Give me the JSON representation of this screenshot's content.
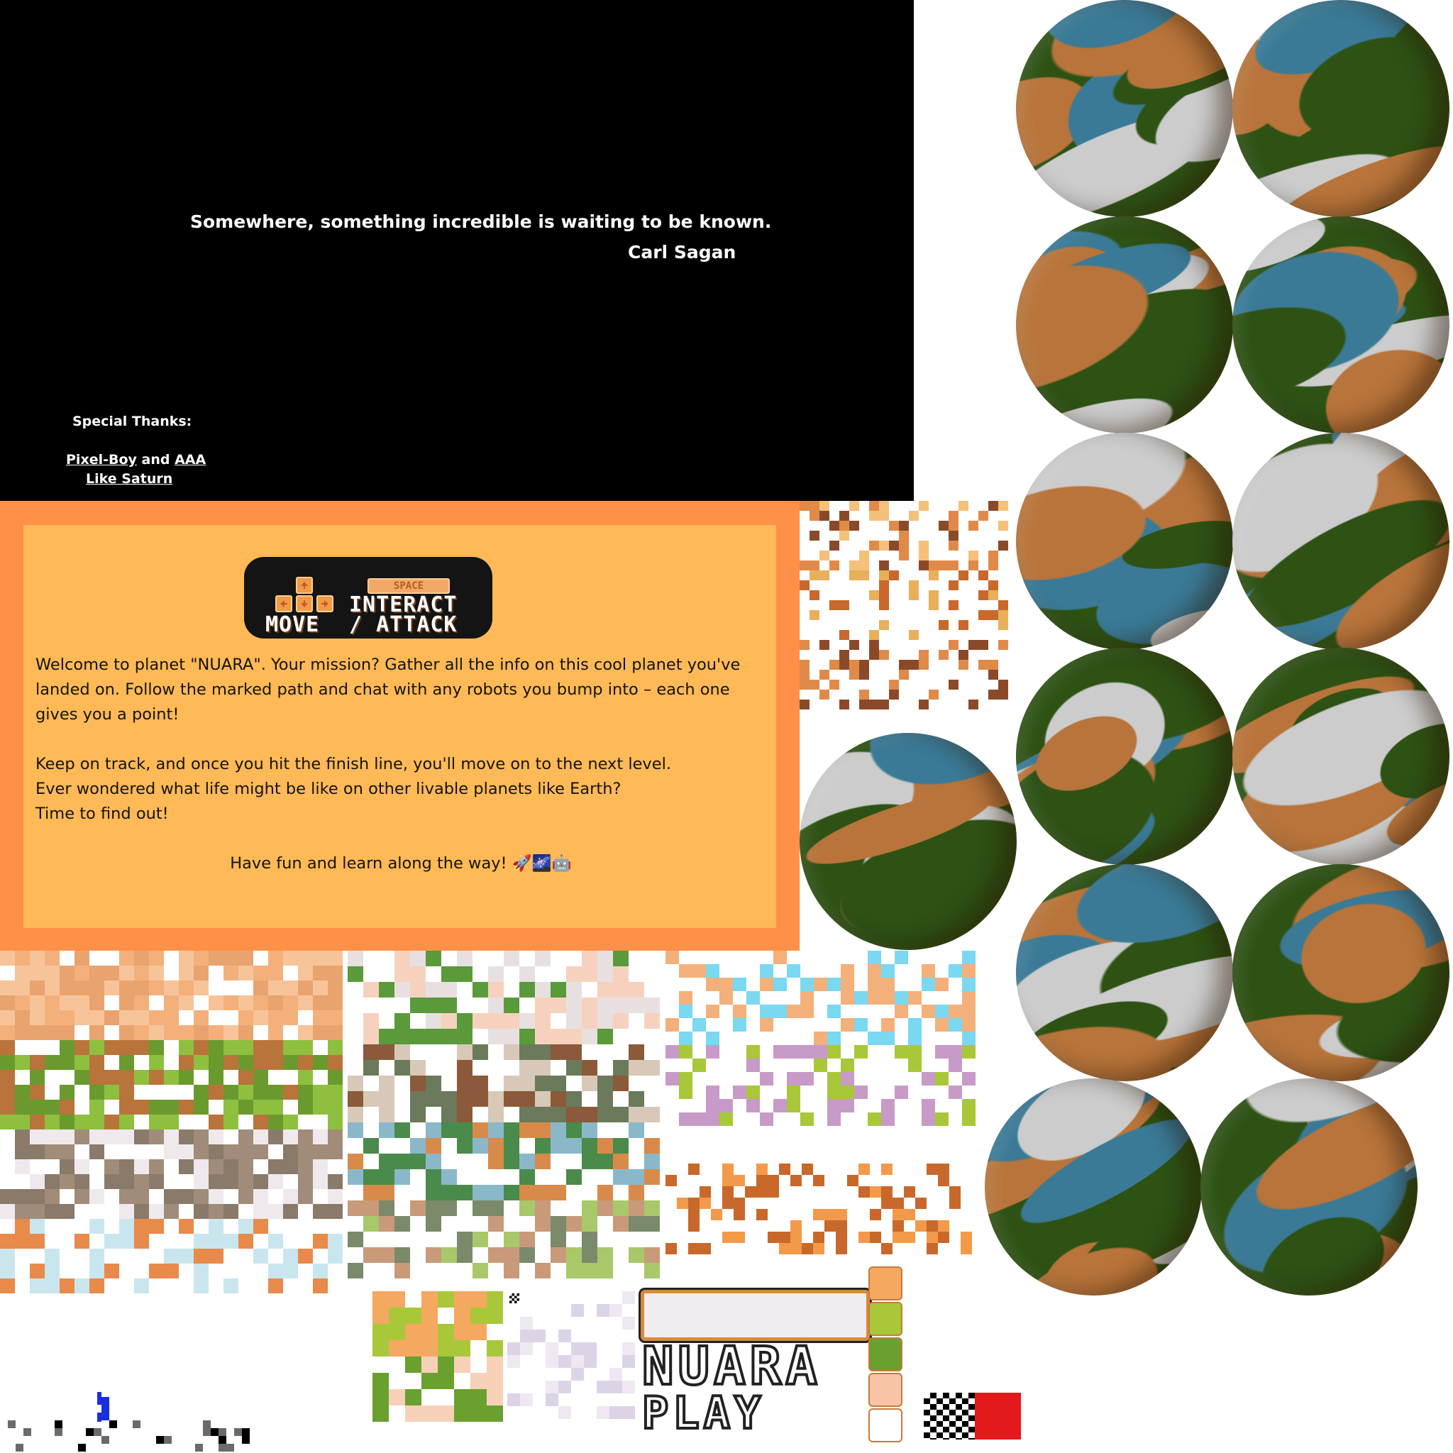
{
  "credits": {
    "quote": "Somewhere, something incredible is waiting to be known.",
    "author": "Carl Sagan",
    "thanks_title": "Special Thanks:",
    "thanks_link1": "Pixel-Boy",
    "thanks_and": " and ",
    "thanks_link2": "AAA",
    "thanks_link3": "Like Saturn"
  },
  "controls": {
    "space_label": "SPACE",
    "move_label": "MOVE",
    "interact_label": "INTERACT",
    "attack_label": "/ ATTACK"
  },
  "info": {
    "p1": "Welcome to planet \"NUARA\". Your mission? Gather all the info on this cool planet you've landed on. Follow the marked path and chat with any robots you bump into – each one gives you a point!",
    "p2_l1": "Keep on track, and once you hit the finish line, you'll move on to the next level.",
    "p2_l2": "Ever wondered what life might be like on other livable planets like Earth?",
    "p2_l3": "Time to find out!",
    "fun": "Have fun and learn along the way! 🚀🌌🤖"
  },
  "title_screen": {
    "logo": "NUARA",
    "play": "PLAY"
  },
  "colors": {
    "planet_green": "#2d5214",
    "planet_orange": "#b8743a",
    "planet_blue": "#3a7a96",
    "planet_grey": "#cccccc",
    "panel_outer": "#ff9048",
    "panel_inner": "#ffb956"
  }
}
